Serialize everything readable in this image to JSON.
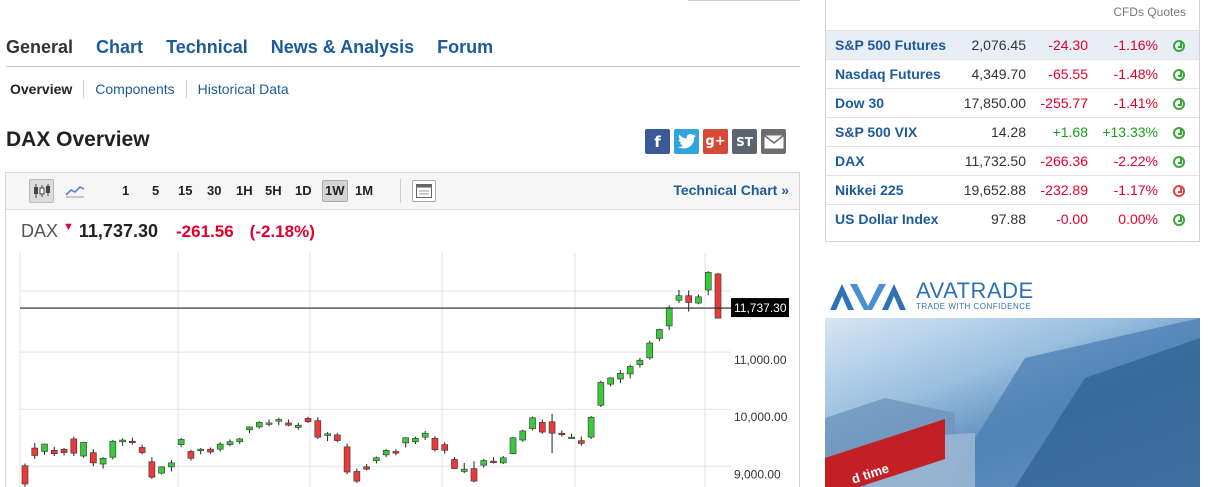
{
  "tabs": [
    {
      "label": "General",
      "active": true
    },
    {
      "label": "Chart"
    },
    {
      "label": "Technical"
    },
    {
      "label": "News & Analysis"
    },
    {
      "label": "Forum"
    }
  ],
  "subtabs": [
    "Overview",
    "Components",
    "Historical Data"
  ],
  "page_title": "DAX Overview",
  "share": {
    "facebook": "f",
    "google": "g+",
    "stocktwits": "ST"
  },
  "toolbar": {
    "timeframes": [
      "1",
      "5",
      "15",
      "30",
      "1H",
      "5H",
      "1D",
      "1W",
      "1M"
    ],
    "active_timeframe": "1W",
    "technical_link": "Technical Chart »"
  },
  "quote": {
    "name": "DAX",
    "last": "11,737.30",
    "change": "-261.56",
    "change_pct": "(-2.18%)"
  },
  "chart_data": {
    "type": "candlestick",
    "current_price_label": "11,737.30",
    "current_price": 11737.3,
    "y_tick_labels": [
      "11,000.00",
      "10,000.00",
      "9,000.00"
    ],
    "y_ticks": [
      11000,
      10000,
      9000
    ],
    "ylim": [
      8900,
      12650
    ],
    "candles": [
      {
        "o": 9150,
        "h": 9190,
        "l": 8780,
        "c": 8830
      },
      {
        "o": 9460,
        "h": 9550,
        "l": 9270,
        "c": 9330
      },
      {
        "o": 9400,
        "h": 9540,
        "l": 9340,
        "c": 9530
      },
      {
        "o": 9420,
        "h": 9480,
        "l": 9320,
        "c": 9360
      },
      {
        "o": 9440,
        "h": 9460,
        "l": 9330,
        "c": 9380
      },
      {
        "o": 9620,
        "h": 9660,
        "l": 9320,
        "c": 9370
      },
      {
        "o": 9320,
        "h": 9570,
        "l": 9290,
        "c": 9560
      },
      {
        "o": 9380,
        "h": 9440,
        "l": 9140,
        "c": 9200
      },
      {
        "o": 9180,
        "h": 9300,
        "l": 9100,
        "c": 9280
      },
      {
        "o": 9300,
        "h": 9600,
        "l": 9260,
        "c": 9580
      },
      {
        "o": 9570,
        "h": 9630,
        "l": 9500,
        "c": 9600
      },
      {
        "o": 9580,
        "h": 9640,
        "l": 9520,
        "c": 9560
      },
      {
        "o": 9470,
        "h": 9520,
        "l": 9350,
        "c": 9380
      },
      {
        "o": 9220,
        "h": 9300,
        "l": 8920,
        "c": 8950
      },
      {
        "o": 9020,
        "h": 9140,
        "l": 9000,
        "c": 9130
      },
      {
        "o": 9130,
        "h": 9250,
        "l": 9050,
        "c": 9200
      },
      {
        "o": 9520,
        "h": 9640,
        "l": 9480,
        "c": 9610
      },
      {
        "o": 9400,
        "h": 9430,
        "l": 9240,
        "c": 9280
      },
      {
        "o": 9420,
        "h": 9460,
        "l": 9350,
        "c": 9440
      },
      {
        "o": 9440,
        "h": 9470,
        "l": 9360,
        "c": 9390
      },
      {
        "o": 9440,
        "h": 9560,
        "l": 9400,
        "c": 9530
      },
      {
        "o": 9520,
        "h": 9610,
        "l": 9490,
        "c": 9570
      },
      {
        "o": 9570,
        "h": 9640,
        "l": 9530,
        "c": 9620
      },
      {
        "o": 9780,
        "h": 9840,
        "l": 9720,
        "c": 9830
      },
      {
        "o": 9830,
        "h": 9930,
        "l": 9800,
        "c": 9910
      },
      {
        "o": 9880,
        "h": 9960,
        "l": 9840,
        "c": 9900
      },
      {
        "o": 9930,
        "h": 9990,
        "l": 9860,
        "c": 9960
      },
      {
        "o": 9900,
        "h": 9960,
        "l": 9840,
        "c": 9860
      },
      {
        "o": 9820,
        "h": 9900,
        "l": 9780,
        "c": 9860
      },
      {
        "o": 9980,
        "h": 10010,
        "l": 9900,
        "c": 9920
      },
      {
        "o": 9940,
        "h": 10000,
        "l": 9620,
        "c": 9650
      },
      {
        "o": 9680,
        "h": 9740,
        "l": 9580,
        "c": 9710
      },
      {
        "o": 9690,
        "h": 9720,
        "l": 9560,
        "c": 9590
      },
      {
        "o": 9480,
        "h": 9540,
        "l": 9000,
        "c": 9040
      },
      {
        "o": 9050,
        "h": 9100,
        "l": 8850,
        "c": 8880
      },
      {
        "o": 9130,
        "h": 9180,
        "l": 9070,
        "c": 9090
      },
      {
        "o": 9240,
        "h": 9310,
        "l": 9190,
        "c": 9290
      },
      {
        "o": 9340,
        "h": 9440,
        "l": 9300,
        "c": 9420
      },
      {
        "o": 9400,
        "h": 9440,
        "l": 9330,
        "c": 9370
      },
      {
        "o": 9550,
        "h": 9650,
        "l": 9470,
        "c": 9640
      },
      {
        "o": 9570,
        "h": 9660,
        "l": 9530,
        "c": 9630
      },
      {
        "o": 9650,
        "h": 9760,
        "l": 9600,
        "c": 9720
      },
      {
        "o": 9630,
        "h": 9670,
        "l": 9400,
        "c": 9430
      },
      {
        "o": 9520,
        "h": 9560,
        "l": 9360,
        "c": 9420
      },
      {
        "o": 9260,
        "h": 9300,
        "l": 9090,
        "c": 9100
      },
      {
        "o": 9050,
        "h": 9200,
        "l": 9020,
        "c": 9090
      },
      {
        "o": 9100,
        "h": 9230,
        "l": 8860,
        "c": 8880
      },
      {
        "o": 9160,
        "h": 9270,
        "l": 9120,
        "c": 9240
      },
      {
        "o": 9230,
        "h": 9300,
        "l": 9190,
        "c": 9210
      },
      {
        "o": 9200,
        "h": 9320,
        "l": 9180,
        "c": 9290
      },
      {
        "o": 9360,
        "h": 9650,
        "l": 9350,
        "c": 9640
      },
      {
        "o": 9600,
        "h": 9780,
        "l": 9570,
        "c": 9760
      },
      {
        "o": 9800,
        "h": 10010,
        "l": 9770,
        "c": 9990
      },
      {
        "o": 9910,
        "h": 9960,
        "l": 9710,
        "c": 9740
      },
      {
        "o": 9920,
        "h": 10060,
        "l": 9370,
        "c": 9720
      },
      {
        "o": 9720,
        "h": 9770,
        "l": 9660,
        "c": 9700
      },
      {
        "o": 9650,
        "h": 9710,
        "l": 9630,
        "c": 9650
      },
      {
        "o": 9590,
        "h": 9660,
        "l": 9500,
        "c": 9540
      },
      {
        "o": 9650,
        "h": 10020,
        "l": 9620,
        "c": 10000
      },
      {
        "o": 10210,
        "h": 10640,
        "l": 10180,
        "c": 10610
      },
      {
        "o": 10580,
        "h": 10700,
        "l": 10540,
        "c": 10690
      },
      {
        "o": 10670,
        "h": 10830,
        "l": 10600,
        "c": 10770
      },
      {
        "o": 10760,
        "h": 10920,
        "l": 10680,
        "c": 10890
      },
      {
        "o": 10920,
        "h": 11040,
        "l": 10870,
        "c": 11000
      },
      {
        "o": 11040,
        "h": 11340,
        "l": 11010,
        "c": 11300
      },
      {
        "o": 11380,
        "h": 11550,
        "l": 11330,
        "c": 11540
      },
      {
        "o": 11600,
        "h": 11960,
        "l": 11530,
        "c": 11920
      },
      {
        "o": 12050,
        "h": 12230,
        "l": 12000,
        "c": 12130
      },
      {
        "o": 12130,
        "h": 12220,
        "l": 11850,
        "c": 12010
      },
      {
        "o": 12000,
        "h": 12150,
        "l": 11980,
        "c": 12110
      },
      {
        "o": 12230,
        "h": 12560,
        "l": 12140,
        "c": 12540
      },
      {
        "o": 12510,
        "h": 12530,
        "l": 11730,
        "c": 11737
      }
    ]
  },
  "quotes_header": "CFDs Quotes",
  "quotes": [
    {
      "name": "S&P 500 Futures",
      "last": "2,076.45",
      "chg": "-24.30",
      "pct": "-1.16%",
      "dir": "neg",
      "clock": "green"
    },
    {
      "name": "Nasdaq Futures",
      "last": "4,349.70",
      "chg": "-65.55",
      "pct": "-1.48%",
      "dir": "neg",
      "clock": "green"
    },
    {
      "name": "Dow 30",
      "last": "17,850.00",
      "chg": "-255.77",
      "pct": "-1.41%",
      "dir": "neg",
      "clock": "green"
    },
    {
      "name": "S&P 500 VIX",
      "last": "14.28",
      "chg": "+1.68",
      "pct": "+13.33%",
      "dir": "pos",
      "clock": "green"
    },
    {
      "name": "DAX",
      "last": "11,732.50",
      "chg": "-266.36",
      "pct": "-2.22%",
      "dir": "neg",
      "clock": "green"
    },
    {
      "name": "Nikkei 225",
      "last": "19,652.88",
      "chg": "-232.89",
      "pct": "-1.17%",
      "dir": "neg",
      "clock": "red"
    },
    {
      "name": "US Dollar Index",
      "last": "97.88",
      "chg": "-0.00",
      "pct": "0.00%",
      "dir": "neg",
      "clock": "green"
    }
  ],
  "ad": {
    "brand": "AVATRADE",
    "tagline": "TRADE WITH CONFIDENCE",
    "banner_text": "d time"
  },
  "colors": {
    "link": "#1c5a9c",
    "up": "#14a01e",
    "down": "#e4002b",
    "candle_up": "#3cc83c",
    "candle_down": "#e83a3a"
  }
}
